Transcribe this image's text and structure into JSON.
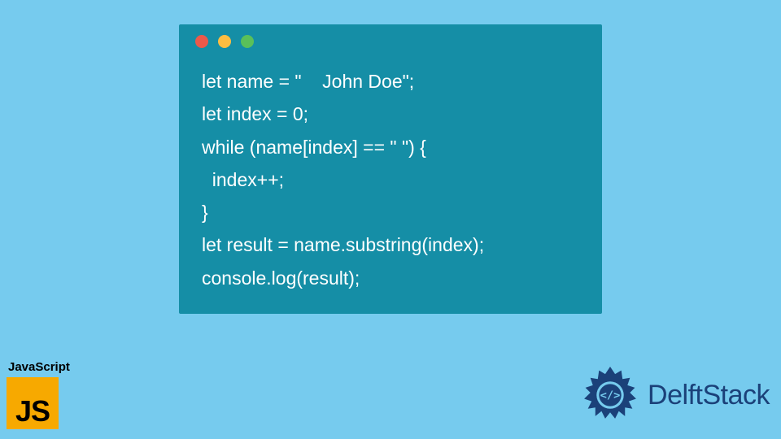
{
  "code_window": {
    "lines": [
      "let name = \"    John Doe\";",
      "let index = 0;",
      "while (name[index] == \" \") {",
      "  index++;",
      "}",
      "let result = name.substring(index);",
      "console.log(result);"
    ]
  },
  "js_badge": {
    "label": "JavaScript",
    "logo_text": "JS"
  },
  "brand": {
    "name": "DelftStack"
  },
  "colors": {
    "page_bg": "#76cbee",
    "window_bg": "#158ea6",
    "code_text": "#ffffff",
    "js_logo_bg": "#f7a900",
    "brand_text": "#1b4179",
    "dot_red": "#ed594a",
    "dot_yellow": "#fdbd41",
    "dot_green": "#5ac05a"
  }
}
